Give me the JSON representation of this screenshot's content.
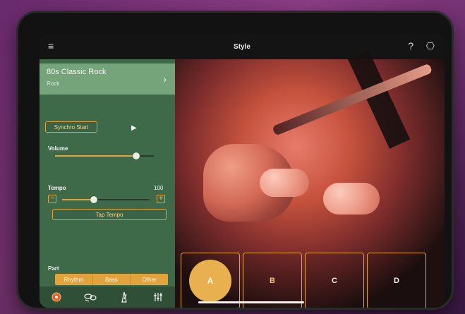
{
  "topbar": {
    "title": "Style",
    "icons": [
      "menu-icon",
      "help-icon",
      "connect-icon"
    ]
  },
  "left_panel": {
    "style": {
      "name": "80s Classic Rock",
      "category": "Rock"
    },
    "buttons": {
      "synchro_start": "Synchro Start",
      "tap_tempo": "Tap Tempo"
    },
    "volume": {
      "label": "Volume",
      "level_fraction": 0.82
    },
    "tempo": {
      "label": "Tempo",
      "value": "100",
      "level_fraction": 0.36
    },
    "part": {
      "label": "Part",
      "options": [
        "Rhythm",
        "Bass",
        "Other"
      ],
      "selected": "Rhythm"
    },
    "bottom_tools": [
      "settings-icon",
      "drum-icon",
      "metronome-icon",
      "mixer-icon"
    ]
  },
  "sections": {
    "labels": [
      "A",
      "B",
      "C",
      "D"
    ],
    "selected": "A"
  },
  "colors": {
    "accent": "#e2a33d",
    "panel": "#3f6a4a",
    "panel_card": "#76a47a",
    "segment": "#e2a33d"
  }
}
